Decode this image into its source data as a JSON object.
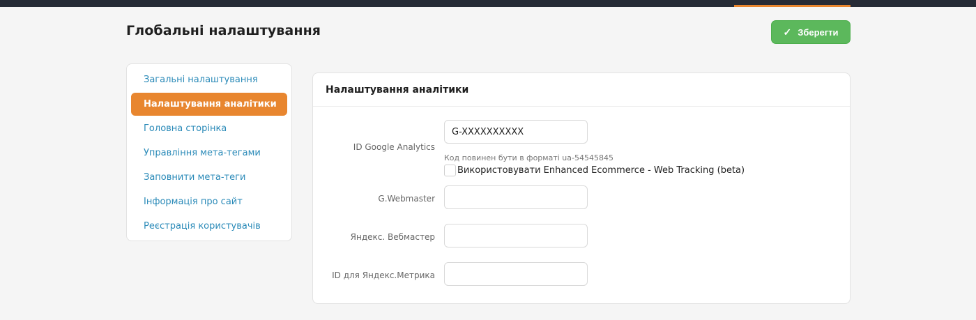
{
  "header": {
    "title": "Глобальні налаштування",
    "save_label": "Зберегти",
    "save_icon": "✓"
  },
  "sidebar": {
    "items": [
      {
        "label": "Загальні налаштування"
      },
      {
        "label": "Налаштування аналітики",
        "active": true
      },
      {
        "label": "Головна сторінка"
      },
      {
        "label": "Управління мета-тегами"
      },
      {
        "label": "Заповнити мета-теги"
      },
      {
        "label": "Інформація про сайт"
      },
      {
        "label": "Реєстрація користувачів"
      }
    ]
  },
  "panel": {
    "title": "Налаштування аналітики",
    "fields": {
      "ga": {
        "label": "ID Google Analytics",
        "value": "G-XXXXXXXXXX",
        "hint": "Код повинен бути в форматі ua-54545845",
        "checkbox_label": "Використовувати Enhanced Ecommerce - Web Tracking (beta)"
      },
      "webmaster": {
        "label": "G.Webmaster",
        "value": ""
      },
      "yandex_webmaster": {
        "label": "Яндекс. Вебмастер",
        "value": ""
      },
      "yandex_metrika": {
        "label": "ID для Яндекс.Метрика",
        "value": ""
      }
    }
  },
  "colors": {
    "accent": "#e8862f",
    "save": "#5cb85c",
    "link": "#2a8ab8",
    "topbar": "#262b36"
  }
}
